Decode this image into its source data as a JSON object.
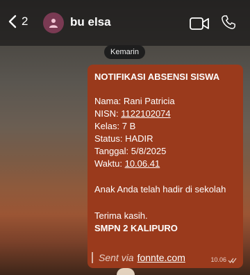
{
  "header": {
    "back_count": "2",
    "contact_name": "bu elsa"
  },
  "date_separator": "Kemarin",
  "message": {
    "title": "NOTIFIKASI ABSENSI SISWA",
    "nama": "Nama: Rani Patricia",
    "nisn_prefix": "NISN: ",
    "nisn_value": "1122102074",
    "kelas": "Kelas: 7 B",
    "status": "Status: HADIR",
    "tanggal": "Tanggal: 5/8/2025",
    "waktu_prefix": "Waktu: ",
    "waktu_value": "10.06.41",
    "body": "Anak Anda telah hadir di sekolah",
    "thanks": "Terima kasih.",
    "school": "SMPN 2 KALIPURO",
    "sent_via": "Sent via",
    "sent_link": "fonnte.com",
    "timestamp": "10.06"
  },
  "colors": {
    "bubble": "#9a3a1c",
    "date_pill": "#1e1e1e",
    "avatar": "#7a3a53"
  },
  "icons": [
    "chevron-left-icon",
    "person-icon",
    "video-camera-icon",
    "phone-icon",
    "double-check-icon"
  ]
}
